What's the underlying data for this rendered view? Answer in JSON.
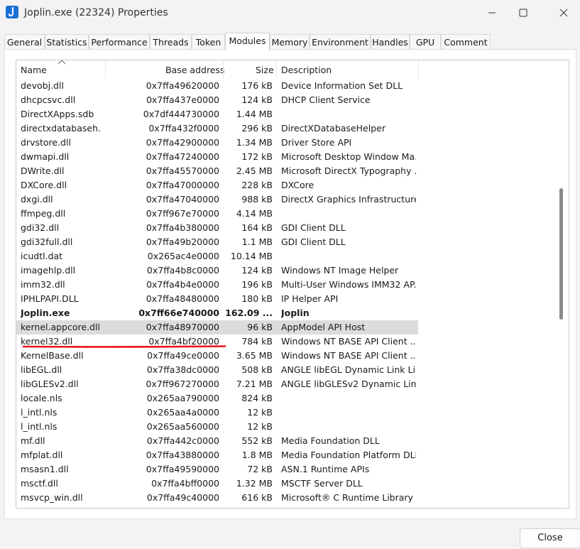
{
  "window": {
    "title": "Joplin.exe (22324) Properties"
  },
  "tabs": [
    {
      "label": "General"
    },
    {
      "label": "Statistics"
    },
    {
      "label": "Performance"
    },
    {
      "label": "Threads"
    },
    {
      "label": "Token"
    },
    {
      "label": "Modules"
    },
    {
      "label": "Memory"
    },
    {
      "label": "Environment"
    },
    {
      "label": "Handles"
    },
    {
      "label": "GPU"
    },
    {
      "label": "Comment"
    }
  ],
  "active_tab": "Modules",
  "columns": {
    "name": "Name",
    "base": "Base address",
    "size": "Size",
    "desc": "Description"
  },
  "modules": [
    {
      "name": "devobj.dll",
      "base": "0x7ffa49620000",
      "size": "176 kB",
      "desc": "Device Information Set DLL"
    },
    {
      "name": "dhcpcsvc.dll",
      "base": "0x7ffa437e0000",
      "size": "124 kB",
      "desc": "DHCP Client Service"
    },
    {
      "name": "DirectXApps.sdb",
      "base": "0x7df444730000",
      "size": "1.44 MB",
      "desc": ""
    },
    {
      "name": "directxdatabaseh...",
      "base": "0x7ffa432f0000",
      "size": "296 kB",
      "desc": "DirectXDatabaseHelper"
    },
    {
      "name": "drvstore.dll",
      "base": "0x7ffa42900000",
      "size": "1.34 MB",
      "desc": "Driver Store API"
    },
    {
      "name": "dwmapi.dll",
      "base": "0x7ffa47240000",
      "size": "172 kB",
      "desc": "Microsoft Desktop Window Ma..."
    },
    {
      "name": "DWrite.dll",
      "base": "0x7ffa45570000",
      "size": "2.45 MB",
      "desc": "Microsoft DirectX Typography ..."
    },
    {
      "name": "DXCore.dll",
      "base": "0x7ffa47000000",
      "size": "228 kB",
      "desc": "DXCore"
    },
    {
      "name": "dxgi.dll",
      "base": "0x7ffa47040000",
      "size": "988 kB",
      "desc": "DirectX Graphics Infrastructure"
    },
    {
      "name": "ffmpeg.dll",
      "base": "0x7ff967e70000",
      "size": "4.14 MB",
      "desc": ""
    },
    {
      "name": "gdi32.dll",
      "base": "0x7ffa4b380000",
      "size": "164 kB",
      "desc": "GDI Client DLL"
    },
    {
      "name": "gdi32full.dll",
      "base": "0x7ffa49b20000",
      "size": "1.1 MB",
      "desc": "GDI Client DLL"
    },
    {
      "name": "icudtl.dat",
      "base": "0x265ac4e0000",
      "size": "10.14 MB",
      "desc": ""
    },
    {
      "name": "imagehlp.dll",
      "base": "0x7ffa4b8c0000",
      "size": "124 kB",
      "desc": "Windows NT Image Helper"
    },
    {
      "name": "imm32.dll",
      "base": "0x7ffa4b4e0000",
      "size": "196 kB",
      "desc": "Multi-User Windows IMM32 AP..."
    },
    {
      "name": "IPHLPAPI.DLL",
      "base": "0x7ffa48480000",
      "size": "180 kB",
      "desc": "IP Helper API"
    },
    {
      "name": "Joplin.exe",
      "base": "0x7ff66e740000",
      "size": "162.09 ...",
      "desc": "Joplin",
      "bold": true
    },
    {
      "name": "kernel.appcore.dll",
      "base": "0x7ffa48970000",
      "size": "96 kB",
      "desc": "AppModel API Host",
      "selected": true
    },
    {
      "name": "kernel32.dll",
      "base": "0x7ffa4bf20000",
      "size": "784 kB",
      "desc": "Windows NT BASE API Client ..."
    },
    {
      "name": "KernelBase.dll",
      "base": "0x7ffa49ce0000",
      "size": "3.65 MB",
      "desc": "Windows NT BASE API Client ..."
    },
    {
      "name": "libEGL.dll",
      "base": "0x7ffa38dc0000",
      "size": "508 kB",
      "desc": "ANGLE libEGL Dynamic Link Lib..."
    },
    {
      "name": "libGLESv2.dll",
      "base": "0x7ff967270000",
      "size": "7.21 MB",
      "desc": "ANGLE libGLESv2 Dynamic Link..."
    },
    {
      "name": "locale.nls",
      "base": "0x265aa790000",
      "size": "824 kB",
      "desc": ""
    },
    {
      "name": "l_intl.nls",
      "base": "0x265aa4a0000",
      "size": "12 kB",
      "desc": ""
    },
    {
      "name": "l_intl.nls",
      "base": "0x265aa560000",
      "size": "12 kB",
      "desc": ""
    },
    {
      "name": "mf.dll",
      "base": "0x7ffa442c0000",
      "size": "552 kB",
      "desc": "Media Foundation DLL"
    },
    {
      "name": "mfplat.dll",
      "base": "0x7ffa43880000",
      "size": "1.8 MB",
      "desc": "Media Foundation Platform DLL"
    },
    {
      "name": "msasn1.dll",
      "base": "0x7ffa49590000",
      "size": "72 kB",
      "desc": "ASN.1 Runtime APIs"
    },
    {
      "name": "msctf.dll",
      "base": "0x7ffa4bff0000",
      "size": "1.32 MB",
      "desc": "MSCTF Server DLL"
    },
    {
      "name": "msvcp_win.dll",
      "base": "0x7ffa49c40000",
      "size": "616 kB",
      "desc": "Microsoft® C Runtime Library"
    }
  ],
  "buttons": {
    "close": "Close"
  },
  "colors": {
    "annotation": "#e8141c",
    "selection": "#dcdcdc",
    "app_icon": "#1d6fd6"
  }
}
